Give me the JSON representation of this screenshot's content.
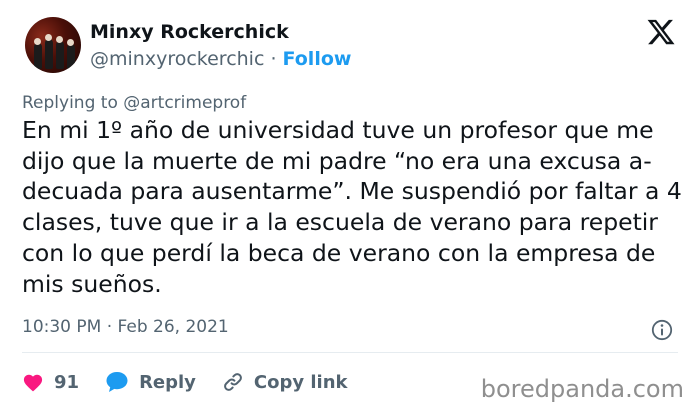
{
  "user": {
    "name": "Minxy Rockerchick",
    "handle": "@minxyrockerchic",
    "separator": "·",
    "follow_label": "Follow"
  },
  "reply": {
    "label": "Replying to",
    "to": "@artcrimeprof"
  },
  "tweet": {
    "text": "En mi 1º año de universidad tuve un profesor que me dijo que la muerte de mi padre “no era una excusa a-decuada para ausentarme”. Me suspendió por faltar a 4 clases, tuve que ir a la escuela de verano para repetir con lo que perdí la beca de verano con la empresa de mis sueños.",
    "time": "10:30 PM · Feb 26, 2021"
  },
  "actions": {
    "likes": "91",
    "reply_label": "Reply",
    "copy_link_label": "Copy link"
  },
  "watermark": "boredpanda.com",
  "colors": {
    "accent": "#1d9bf0",
    "like": "#f91880",
    "text": "#0f1419",
    "muted": "#536471"
  },
  "icons": [
    "x-logo-icon",
    "info-icon",
    "heart-icon",
    "reply-bubble-icon",
    "link-icon"
  ]
}
